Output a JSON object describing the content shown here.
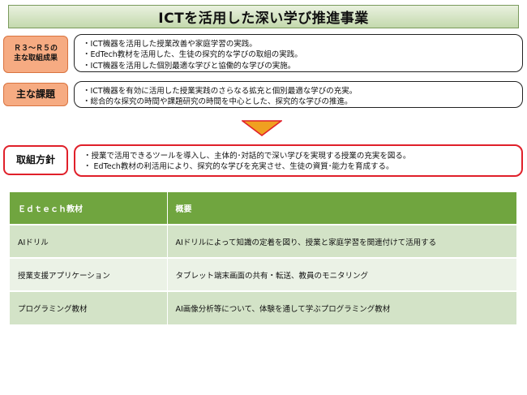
{
  "title": "ICTを活用した深い学び推進事業",
  "sections": [
    {
      "label_lines": [
        "Ｒ３～Ｒ５の",
        "主な取組成果"
      ],
      "lines": [
        "・ICT機器を活用した授業改善や家庭学習の実践。",
        "・EdTech教材を活用した、生徒の探究的な学びの取組の実践。",
        "・ICT機器を活用した個別最適な学びと協働的な学びの実施。"
      ]
    },
    {
      "label_lines": [
        "主な課題"
      ],
      "lines": [
        "・ICT機器を有効に活用した授業実践のさらなる拡充と個別最適な学びの充実。",
        "・総合的な探究の時間や課題研究の時間を中心とした、探究的な学びの推進。"
      ]
    },
    {
      "label_lines": [
        "取組方針"
      ],
      "lines": [
        "・授業で活用できるツールを導入し、主体的･対話的で深い学びを実現する授業の充実を図る。",
        "・ EdTech教材の利活用により、探究的な学びを充実させ、生徒の資質･能力を育成する。"
      ]
    }
  ],
  "arrow_color": "#f0a020",
  "table": {
    "headers": [
      "Ｅｄｔｅｃｈ教材",
      "概要"
    ],
    "rows": [
      [
        "AIドリル",
        "AIドリルによって知識の定着を図り、授業と家庭学習を関連付けて活用する"
      ],
      [
        "授業支援アプリケーション",
        "タブレット端末画面の共有・転送、教員のモニタリング"
      ],
      [
        "プログラミング教材",
        "AI画像分析等について、体験を通して学ぶプログラミング教材"
      ]
    ]
  }
}
